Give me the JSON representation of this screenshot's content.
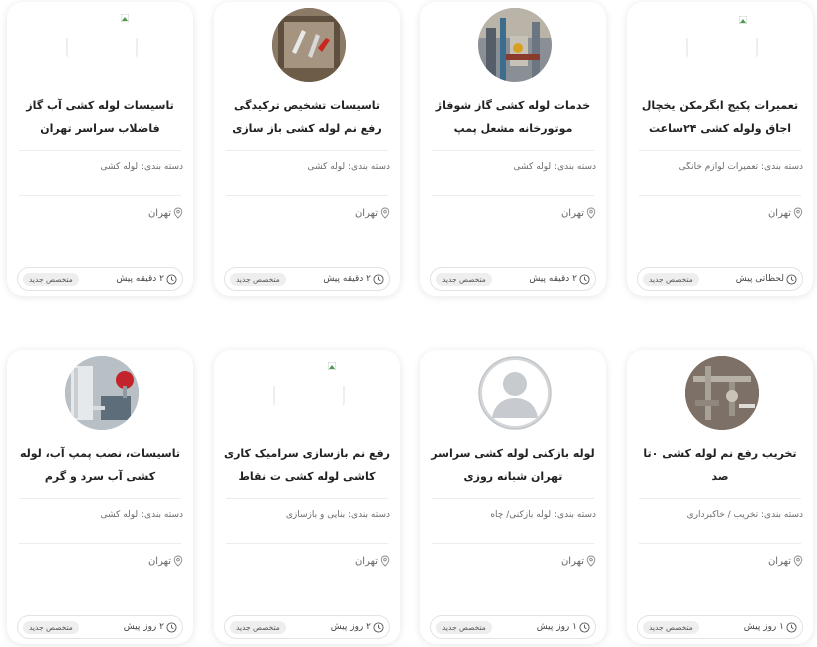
{
  "cards": [
    {
      "title": "تاسیسات لوله کشی آب گاز فاضلاب سراسر تهران",
      "category": "دسته بندی: لوله کشی",
      "location": "تهران",
      "time": "۲ دقیقه پیش",
      "badge": "متخصص جدید",
      "avatar": "broken-image-icon"
    },
    {
      "title": "تاسیسات تشخیص ترکیدگی رفع نم لوله کشی باز سازی",
      "category": "دسته بندی: لوله کشی",
      "location": "تهران",
      "time": "۲ دقیقه پیش",
      "badge": "متخصص جدید",
      "avatar": "pipes-photo"
    },
    {
      "title": "خدمات لوله کشی گاز شوفاژ موتورخانه مشعل پمپ",
      "category": "دسته بندی: لوله کشی",
      "location": "تهران",
      "time": "۲ دقیقه پیش",
      "badge": "متخصص جدید",
      "avatar": "boiler-room-photo"
    },
    {
      "title": "تعمیرات پکیج ابگرمکن یخچال اجاق ولوله کشی ۲۴ساعت",
      "category": "دسته بندی: تعمیرات لوازم خانگی",
      "location": "تهران",
      "time": "لحظاتی پیش",
      "badge": "متخصص جدید",
      "avatar": "broken-image-icon"
    },
    {
      "title": "تاسیسات، نصب پمپ آب، لوله کشی آب سرد و گرم",
      "category": "دسته بندی: لوله کشی",
      "location": "تهران",
      "time": "۲ روز پیش",
      "badge": "متخصص جدید",
      "avatar": "water-pump-photo"
    },
    {
      "title": "رفع نم بازسازی سرامیک کاری کاشی لوله کشی ت نقاط",
      "category": "دسته بندی: بنایی و بازسازی",
      "location": "تهران",
      "time": "۲ روز پیش",
      "badge": "متخصص جدید",
      "avatar": "broken-image-icon"
    },
    {
      "title": "لوله بازکنی لوله کشی سراسر تهران شبانه روزی",
      "category": "دسته بندی: لوله بازکنی/ چاه",
      "location": "تهران",
      "time": "۱ روز پیش",
      "badge": "متخصص جدید",
      "avatar": "default-user-icon"
    },
    {
      "title": "تخریب رفع نم لوله کشی ۰تا صد",
      "category": "دسته بندی: تخریب / خاکبرداری",
      "location": "تهران",
      "time": "۱ روز پیش",
      "badge": "متخصص جدید",
      "avatar": "plumbing-photo"
    }
  ]
}
